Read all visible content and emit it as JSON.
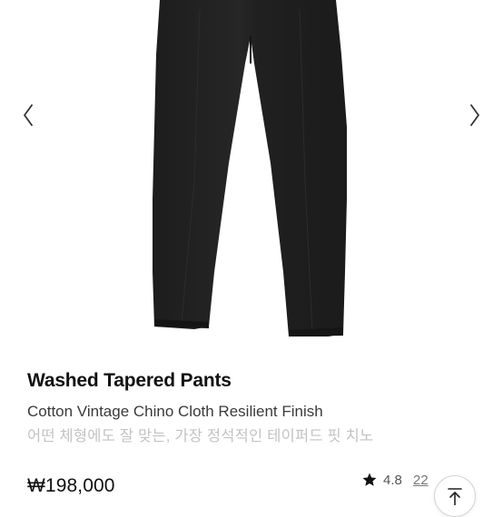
{
  "gallery": {
    "image_alt": "washed-tapered-pants-black",
    "prev_icon": "chevron-left-icon",
    "next_icon": "chevron-right-icon"
  },
  "product": {
    "name": "Washed Tapered Pants",
    "subtitle": "Cotton Vintage Chino Cloth Resilient Finish",
    "description": "어떤 체형에도 잘 맞는, 가장 정석적인 테이퍼드 핏 치노",
    "price": "₩198,000",
    "rating": "4.8",
    "reviews": "22"
  },
  "icons": {
    "star": "star-icon",
    "scroll_top": "arrow-up-icon"
  },
  "colors": {
    "pants": "#222222",
    "description_text": "#c3c3c3"
  }
}
